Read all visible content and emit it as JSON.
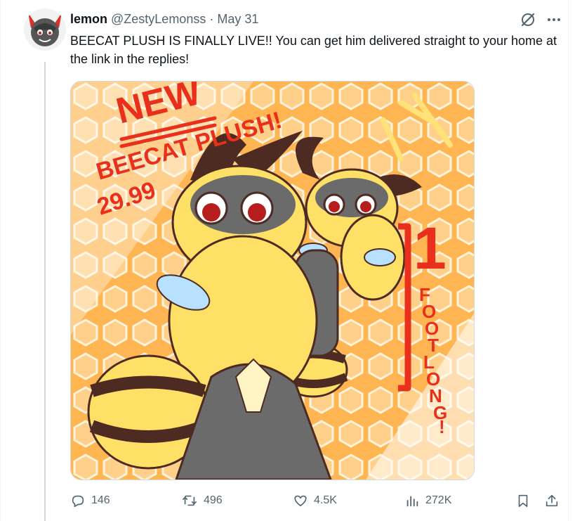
{
  "tweet": {
    "author": {
      "display_name": "lemon",
      "handle": "@ZestyLemonss"
    },
    "separator": "·",
    "date": "May 31",
    "text": "BEECAT PLUSH IS FINALLY LIVE!! You can get him delivered straight to your home at the link in the replies!",
    "media": {
      "headline": "NEW",
      "subtitle": "BEECAT PLUSH!",
      "price": "29.99",
      "size_number": "1",
      "size_letters": [
        "F",
        "O",
        "O",
        "T",
        "L",
        "O",
        "N",
        "G",
        "!"
      ]
    },
    "stats": {
      "replies": "146",
      "reposts": "496",
      "likes": "4.5K",
      "views": "272K"
    }
  },
  "colors": {
    "text_primary": "#0f1419",
    "text_secondary": "#536471",
    "thread_line": "#cfd9de",
    "ad_red": "#e8301c",
    "bee_yellow": "#ffe066",
    "bee_dark": "#4d2a22",
    "honeycomb": "#ffb552"
  },
  "icons": [
    "avatar",
    "grok-icon",
    "more-icon",
    "reply-icon",
    "repost-icon",
    "like-icon",
    "views-icon",
    "bookmark-icon",
    "share-icon"
  ]
}
